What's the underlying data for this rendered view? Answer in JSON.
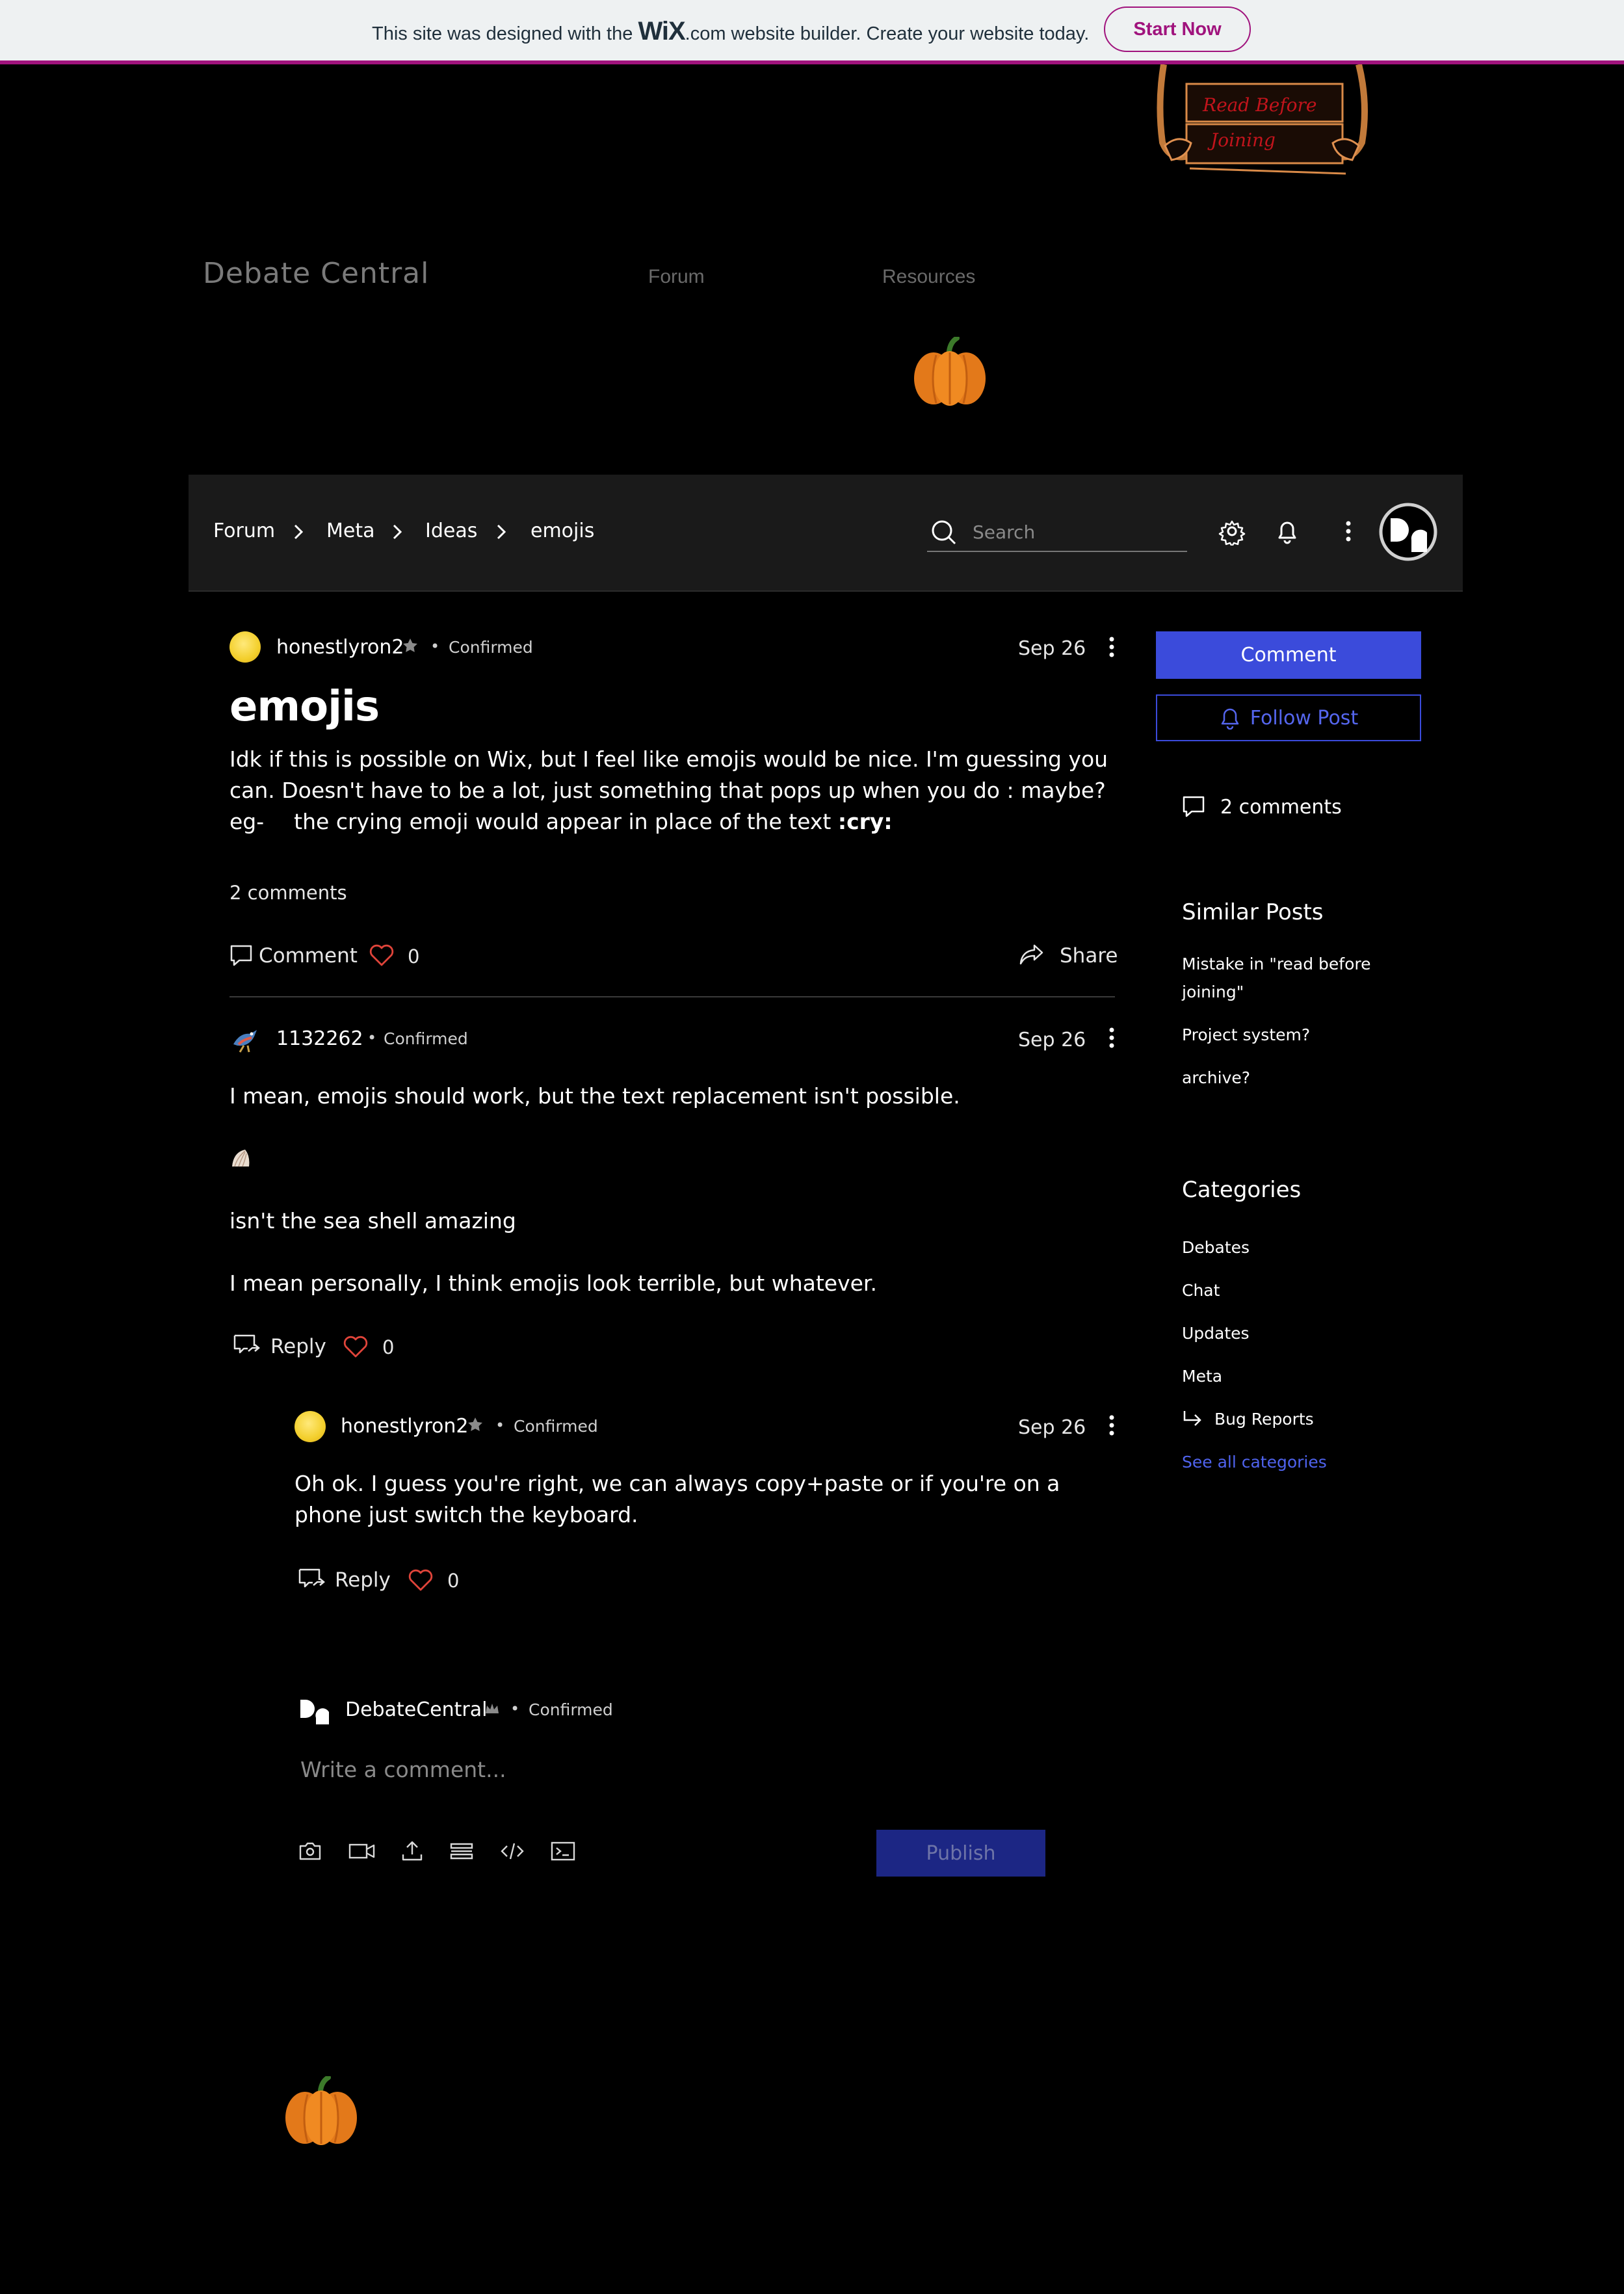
{
  "wix_banner": {
    "text_before": "This site was designed with the",
    "logo": "WiX",
    "text_after": ".com website builder. Create your website today.",
    "cta": "Start Now"
  },
  "header": {
    "sign_text": [
      "Read Before",
      "Joining"
    ],
    "site_title": "Debate Central",
    "nav": [
      "Forum",
      "Resources"
    ]
  },
  "forum_bar": {
    "breadcrumbs": [
      "Forum",
      "Meta",
      "Ideas",
      "emojis"
    ],
    "search_placeholder": "Search"
  },
  "post": {
    "author": "honestlyron2",
    "badge": "Confirmed",
    "date": "Sep 26",
    "title": "emojis",
    "body_lines": [
      "Idk if this is possible on Wix, but I feel like emojis would be nice. I'm guessing you",
      "can. Doesn't have to be a lot, just something that pops up when you do : maybe?"
    ],
    "body_eg": "eg-",
    "body_last": "the crying emoji would appear in place of the text",
    "body_code": ":cry:",
    "comment_count": "2 comments",
    "comment_label": "Comment",
    "likes": "0",
    "share_label": "Share"
  },
  "comments": [
    {
      "author": "1132262",
      "badge": "Confirmed",
      "date": "Sep 26",
      "paragraphs": [
        "I mean, emojis should work, but the text replacement isn't possible.",
        "isn't the sea shell amazing",
        "I mean personally, I think emojis look terrible, but whatever."
      ],
      "reply_label": "Reply",
      "likes": "0"
    },
    {
      "author": "honestlyron2",
      "badge": "Confirmed",
      "date": "Sep 26",
      "paragraphs": [
        "Oh ok. I guess you're right, we can always copy+paste or if you're on a",
        "phone just switch the keyboard."
      ],
      "reply_label": "Reply",
      "likes": "0"
    }
  ],
  "composer": {
    "author": "DebateCentral",
    "badge": "Confirmed",
    "placeholder": "Write a comment...",
    "publish_label": "Publish"
  },
  "sidebar": {
    "comment_button": "Comment",
    "follow_button": "Follow Post",
    "comment_count": "2 comments",
    "similar_title": "Similar Posts",
    "similar_posts": [
      "Mistake in \"read before joining\"",
      "Project system?",
      "archive?"
    ],
    "categories_title": "Categories",
    "categories": [
      "Debates",
      "Chat",
      "Updates",
      "Meta"
    ],
    "subcategory": "Bug Reports",
    "see_all": "See all categories"
  },
  "colors": {
    "accent": "#3b4bdb",
    "wix_brand": "#a0137d",
    "like_heart": "#e0443a",
    "background": "#000000"
  }
}
